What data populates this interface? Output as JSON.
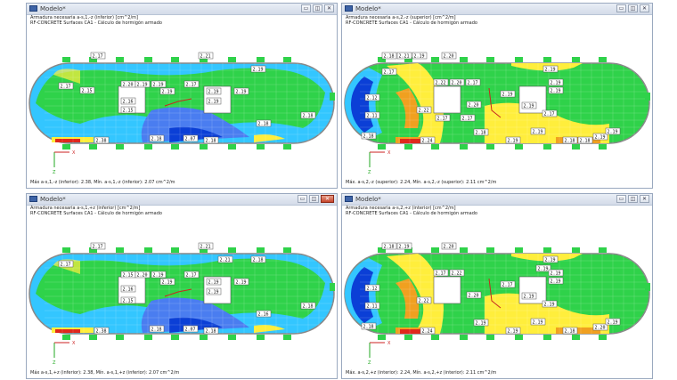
{
  "windows": [
    {
      "title": "Modelo*",
      "line1": "Armadura necesaria a-s,1,-z (inferior) [cm^2/m]",
      "line2": "RF-CONCRETE Surfaces CA1 - Cálculo de hormigón armado",
      "footer": "Máx a-s,1,-z (inferior): 2.38, Mín. a-s,1,-z (inferior): 2.07 cm^2/m",
      "labels": [
        "2.17",
        "2.21",
        "2.17",
        "2.15",
        "2.20",
        "2.19",
        "2.19",
        "2.19",
        "2.17",
        "2.19",
        "2.19",
        "2.19",
        "2.16",
        "2.15",
        "2.19",
        "2.18",
        "2.07",
        "2.18",
        "2.38",
        "2.18",
        "2.18"
      ]
    },
    {
      "title": "Modelo*",
      "line1": "Armadura necesaria a-s,2,-z (superior) [cm^2/m]",
      "line2": "RF-CONCRETE Surfaces CA1 - Cálculo de hormigón armado",
      "footer": "Máx. a-s,2,-z (superior): 2.24, Mín. a-s,2,-z (superior): 2.11 cm^2/m",
      "labels": [
        "2.18",
        "2.21",
        "2.19",
        "2.20",
        "2.19",
        "2.17",
        "2.22",
        "2.20",
        "2.17",
        "2.19",
        "2.19",
        "2.12",
        "2.11",
        "2.19",
        "2.17",
        "2.22",
        "2.20",
        "2.17",
        "2.19",
        "2.17",
        "2.18",
        "2.18",
        "2.19",
        "2.24",
        "2.19",
        "2.18",
        "2.18",
        "2.19",
        "2.19"
      ]
    },
    {
      "title": "Modelo*",
      "line1": "Armadura necesaria a-s,1,+z (inferior) [cm^2/m]",
      "line2": "RF-CONCRETE Surfaces CA1 - Cálculo de hormigón armado",
      "footer": "Máx a-s,1,+z (inferior): 2.38, Mín. a-s,1,+z (inferior): 2.07 cm^2/m",
      "labels": [
        "2.17",
        "2.21",
        "2.17",
        "2.15",
        "2.20",
        "2.19",
        "2.17",
        "2.19",
        "2.16",
        "2.19",
        "2.19",
        "2.15",
        "2.19",
        "2.18",
        "2.16",
        "2.07",
        "2.18",
        "2.38",
        "2.18",
        "2.18",
        "2.21"
      ]
    },
    {
      "title": "Modelo*",
      "line1": "Armadura necesaria a-s,2,+z (interior) [cm^2/m]",
      "line2": "RF-CONCRETE Surfaces CA1 - Cálculo de hormigón armado",
      "footer": "Máx. a-s,2,+z (interior): 2.24, Mín. a-s,2,+z (interior): 2.11 cm^2/m",
      "labels": [
        "2.18",
        "2.19",
        "2.20",
        "2.19",
        "2.19",
        "2.12",
        "2.17",
        "2.22",
        "2.11",
        "2.19",
        "2.19",
        "2.17",
        "2.19",
        "2.22",
        "2.20",
        "2.19",
        "2.19",
        "2.18",
        "2.19",
        "2.24",
        "2.19",
        "2.18",
        "2.20",
        "2.19"
      ]
    }
  ],
  "axes": {
    "x": "X",
    "z": "Z"
  },
  "colors": {
    "blue": "#0b3fd6",
    "cyan": "#33c6ff",
    "green": "#2fd24a",
    "yellow": "#ffee3c",
    "orange": "#f0a020",
    "red": "#e0281c"
  }
}
